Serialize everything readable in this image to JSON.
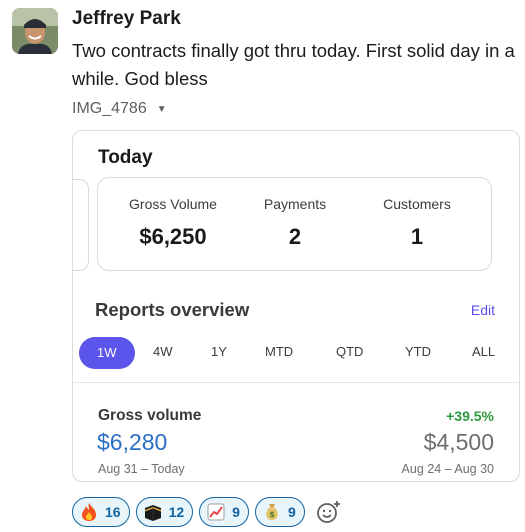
{
  "message": {
    "author": "Jeffrey Park",
    "text": "Two contracts finally got thru today. First solid day in a while. God bless",
    "attachment_name": "IMG_4786"
  },
  "screenshot": {
    "today_title": "Today",
    "metrics": [
      {
        "label": "Gross Volume",
        "value": "$6,250"
      },
      {
        "label": "Payments",
        "value": "2"
      },
      {
        "label": "Customers",
        "value": "1"
      }
    ],
    "reports_title": "Reports overview",
    "edit_label": "Edit",
    "ranges": [
      "1W",
      "4W",
      "1Y",
      "MTD",
      "QTD",
      "YTD",
      "ALL"
    ],
    "active_range": "1W",
    "gross_volume": {
      "label": "Gross volume",
      "change": "+39.5%",
      "current": "$6,280",
      "previous": "$4,500",
      "current_range": "Aug 31 – Today",
      "previous_range": "Aug 24 – Aug 30"
    }
  },
  "reactions": [
    {
      "emoji": "fire-icon",
      "count": "16"
    },
    {
      "emoji": "kaaba-icon",
      "count": "12"
    },
    {
      "emoji": "chart-increasing-icon",
      "count": "9"
    },
    {
      "emoji": "money-bag-icon",
      "count": "9"
    }
  ],
  "colors": {
    "accent": "#5b55ec",
    "link": "#2b6fc4",
    "positive": "#2e9a3e",
    "reaction_border": "#1264a3",
    "reaction_bg": "#e8f5fa"
  }
}
